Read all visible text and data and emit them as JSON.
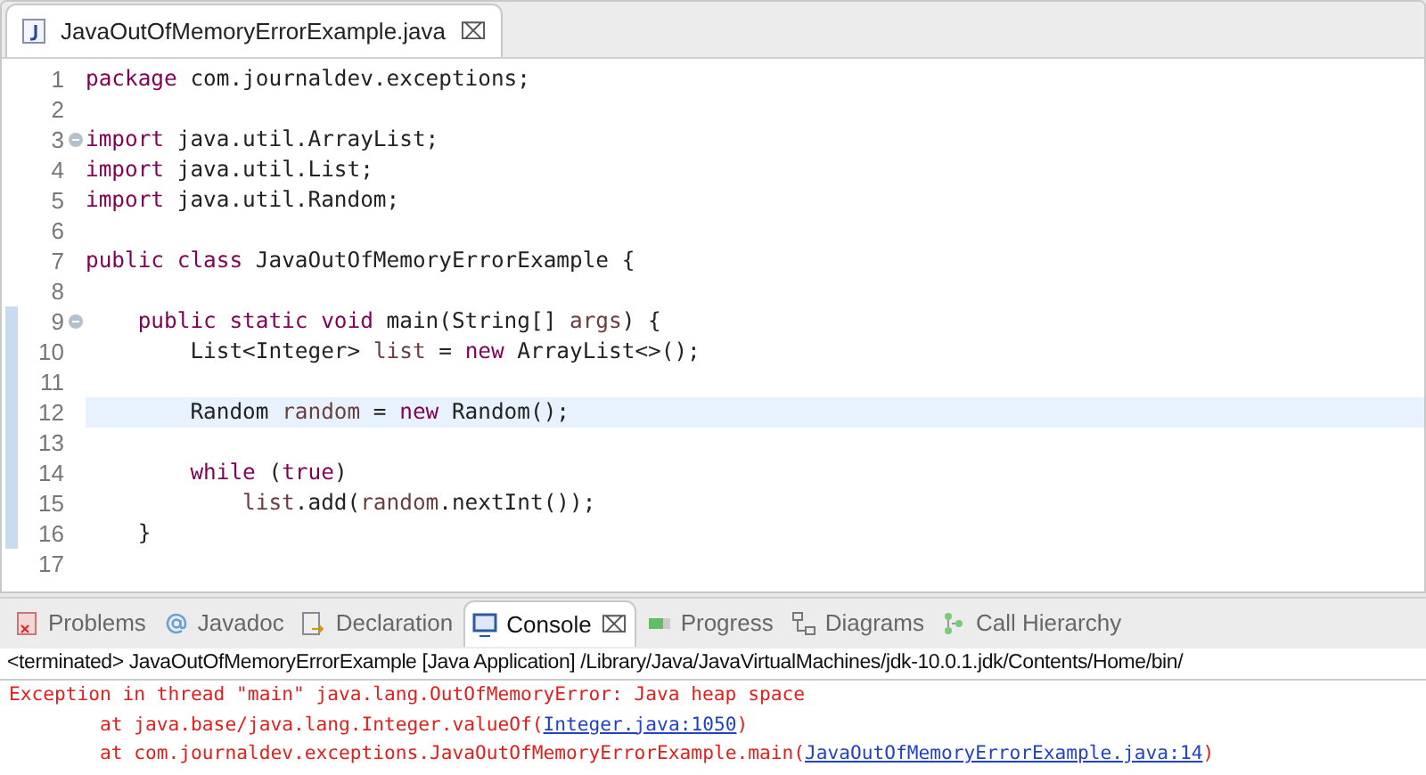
{
  "editor": {
    "tab": {
      "title": "JavaOutOfMemoryErrorExample.java",
      "close": "⌧"
    },
    "lines": [
      {
        "number": "1",
        "fold": false,
        "in_range": false,
        "current": false,
        "tokens": [
          {
            "kind": "keyword",
            "text": "package"
          },
          {
            "kind": "plain",
            "text": " com.journaldev.exceptions;"
          }
        ]
      },
      {
        "number": "2",
        "fold": false,
        "in_range": false,
        "current": false
      },
      {
        "number": "3",
        "fold": true,
        "in_range": false,
        "current": false,
        "tokens": [
          {
            "kind": "keyword",
            "text": "import"
          },
          {
            "kind": "plain",
            "text": " java.util.ArrayList;"
          }
        ]
      },
      {
        "number": "4",
        "fold": false,
        "in_range": false,
        "current": false,
        "tokens": [
          {
            "kind": "keyword",
            "text": "import"
          },
          {
            "kind": "plain",
            "text": " java.util.List;"
          }
        ]
      },
      {
        "number": "5",
        "fold": false,
        "in_range": false,
        "current": false,
        "tokens": [
          {
            "kind": "keyword",
            "text": "import"
          },
          {
            "kind": "plain",
            "text": " java.util.Random;"
          }
        ]
      },
      {
        "number": "6",
        "fold": false,
        "in_range": false,
        "current": false
      },
      {
        "number": "7",
        "fold": false,
        "in_range": false,
        "current": false,
        "tokens": [
          {
            "kind": "keyword",
            "text": "public class"
          },
          {
            "kind": "plain",
            "text": " JavaOutOfMemoryErrorExample {"
          }
        ]
      },
      {
        "number": "8",
        "fold": false,
        "in_range": false,
        "current": false
      },
      {
        "number": "9",
        "fold": true,
        "in_range": true,
        "current": false,
        "tokens": [
          {
            "kind": "keyword",
            "text": "    public static void"
          },
          {
            "kind": "plain",
            "text": " main(String[] "
          },
          {
            "kind": "local",
            "text": "args"
          },
          {
            "kind": "plain",
            "text": ") {"
          }
        ]
      },
      {
        "number": "10",
        "fold": false,
        "in_range": true,
        "current": false,
        "tokens": [
          {
            "kind": "plain",
            "text": "        List<Integer> "
          },
          {
            "kind": "local",
            "text": "list"
          },
          {
            "kind": "plain",
            "text": " = "
          },
          {
            "kind": "keyword",
            "text": "new"
          },
          {
            "kind": "plain",
            "text": " ArrayList<>();"
          }
        ]
      },
      {
        "number": "11",
        "fold": false,
        "in_range": true,
        "current": false
      },
      {
        "number": "12",
        "fold": false,
        "in_range": true,
        "current": true,
        "tokens": [
          {
            "kind": "plain",
            "text": "        Random "
          },
          {
            "kind": "local",
            "text": "random"
          },
          {
            "kind": "plain",
            "text": " = "
          },
          {
            "kind": "keyword",
            "text": "new"
          },
          {
            "kind": "plain",
            "text": " Random();"
          }
        ]
      },
      {
        "number": "13",
        "fold": false,
        "in_range": true,
        "current": false
      },
      {
        "number": "14",
        "fold": false,
        "in_range": true,
        "current": false,
        "tokens": [
          {
            "kind": "keyword",
            "text": "        while"
          },
          {
            "kind": "plain",
            "text": " ("
          },
          {
            "kind": "keyword",
            "text": "true"
          },
          {
            "kind": "plain",
            "text": ")"
          }
        ]
      },
      {
        "number": "15",
        "fold": false,
        "in_range": true,
        "current": false,
        "tokens": [
          {
            "kind": "local",
            "text": "            list"
          },
          {
            "kind": "plain",
            "text": ".add("
          },
          {
            "kind": "local",
            "text": "random"
          },
          {
            "kind": "plain",
            "text": ".nextInt());"
          }
        ]
      },
      {
        "number": "16",
        "fold": false,
        "in_range": true,
        "current": false,
        "tokens": [
          {
            "kind": "plain",
            "text": "    }"
          }
        ]
      },
      {
        "number": "17",
        "fold": false,
        "in_range": false,
        "current": false
      }
    ]
  },
  "panel": {
    "tabs": [
      {
        "kind": "problems",
        "label": "Problems",
        "selected": false
      },
      {
        "kind": "javadoc",
        "label": "Javadoc",
        "selected": false
      },
      {
        "kind": "declaration",
        "label": "Declaration",
        "selected": false
      },
      {
        "kind": "console",
        "label": "Console",
        "selected": true,
        "close": "⌧"
      },
      {
        "kind": "progress",
        "label": "Progress",
        "selected": false
      },
      {
        "kind": "diagrams",
        "label": "Diagrams",
        "selected": false
      },
      {
        "kind": "hierarchy",
        "label": "Call Hierarchy",
        "selected": false
      }
    ],
    "console_title": "<terminated> JavaOutOfMemoryErrorExample [Java Application] /Library/Java/JavaVirtualMachines/jdk-10.0.1.jdk/Contents/Home/bin/",
    "output": [
      {
        "text": "Exception in thread \"main\" java.lang.OutOfMemoryError: Java heap space"
      },
      {
        "text": "\tat java.base/java.lang.Integer.valueOf(",
        "link": "Integer.java:1050",
        "after": ")"
      },
      {
        "text": "\tat com.journaldev.exceptions.JavaOutOfMemoryErrorExample.main(",
        "link": "JavaOutOfMemoryErrorExample.java:14",
        "after": ")"
      }
    ]
  }
}
